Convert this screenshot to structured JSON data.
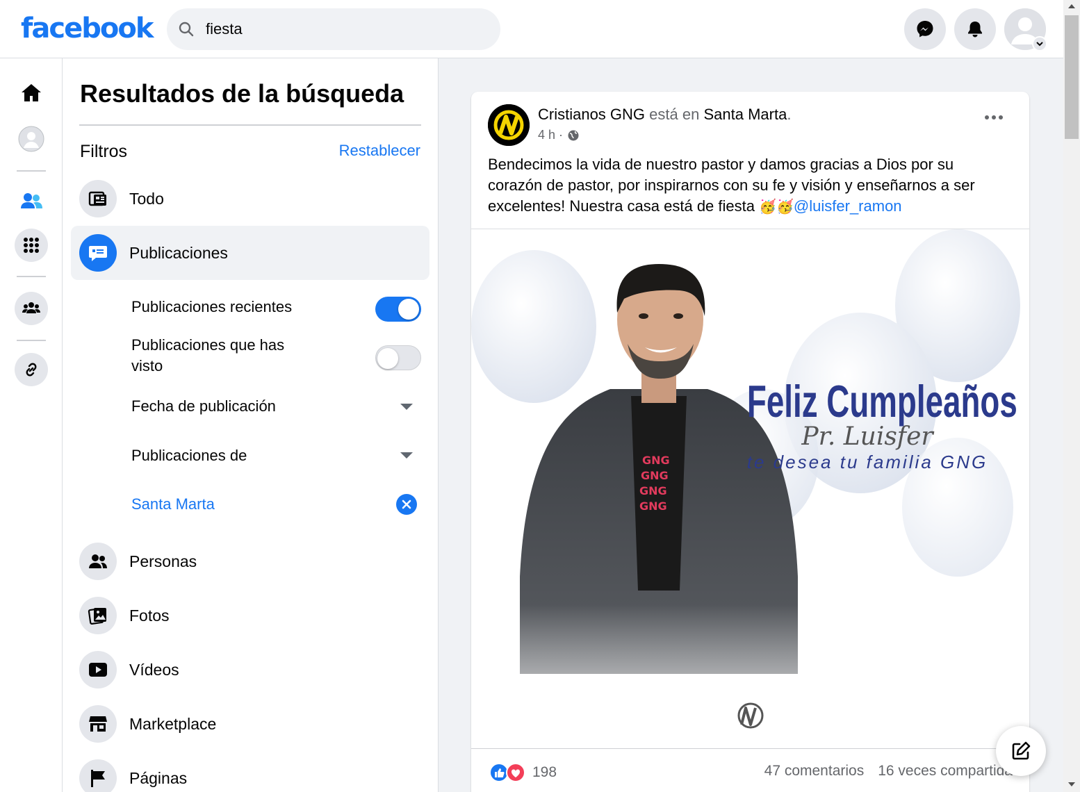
{
  "header": {
    "logo": "facebook",
    "search_value": "fiesta"
  },
  "panel": {
    "title": "Resultados de la búsqueda",
    "filters_label": "Filtros",
    "reset_label": "Restablecer",
    "categories": [
      {
        "label": "Todo",
        "icon": "feed-icon"
      },
      {
        "label": "Publicaciones",
        "icon": "posts-icon",
        "active": true
      },
      {
        "label": "Personas",
        "icon": "people-icon"
      },
      {
        "label": "Fotos",
        "icon": "photos-icon"
      },
      {
        "label": "Vídeos",
        "icon": "video-icon"
      },
      {
        "label": "Marketplace",
        "icon": "marketplace-icon"
      },
      {
        "label": "Páginas",
        "icon": "flag-icon"
      }
    ],
    "sub_filters": {
      "recent": {
        "label": "Publicaciones recientes",
        "on": true
      },
      "seen": {
        "label": "Publicaciones que has visto",
        "on": false
      },
      "date": {
        "label": "Fecha de publicación"
      },
      "from": {
        "label": "Publicaciones de"
      },
      "location": {
        "label": "Santa Marta"
      }
    }
  },
  "post": {
    "page_name": "Cristianos GNG",
    "is_at": "está en",
    "location": "Santa Marta",
    "location_suffix": ".",
    "time": "4 h ·",
    "text": "Bendecimos la vida de nuestro pastor y damos gracias a Dios por su corazón de pastor, por inspirarnos con su fe y visión y enseñarnos a ser excelentes! Nuestra casa está de fiesta ",
    "emojis": "🥳🥳",
    "mention": "@luisfer_ramon",
    "image": {
      "title": "Feliz Cumpleaños",
      "script": "Pr. Luisfer",
      "subtitle": "te desea tu familia GNG",
      "shirt_text": "GNG"
    },
    "reaction_count": "198",
    "comments": "47 comentarios",
    "shares": "16 veces compartida"
  },
  "colors": {
    "brand": "#1877f2",
    "text": "#050505",
    "muted": "#65676b",
    "background": "#f0f2f5"
  }
}
